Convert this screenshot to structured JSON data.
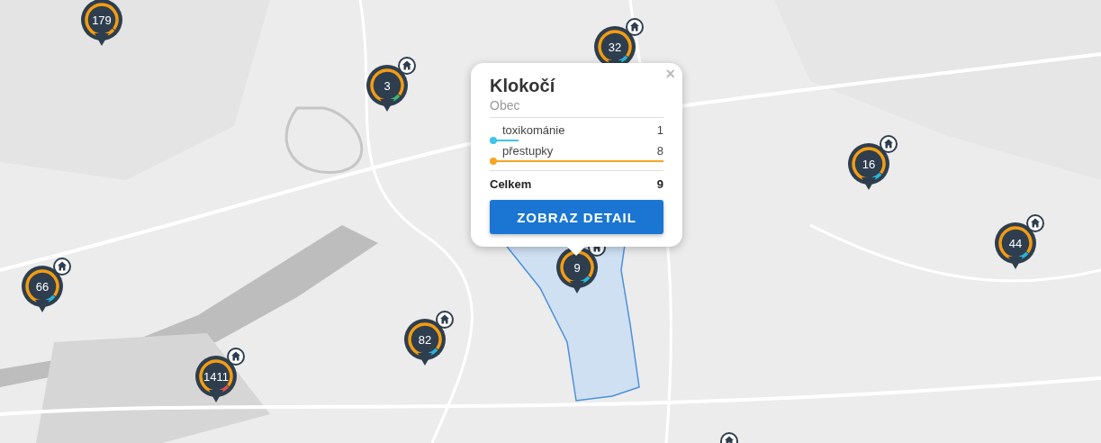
{
  "pins": [
    {
      "count": "179",
      "home": false,
      "color": "#f39c12"
    },
    {
      "count": "3",
      "home": true,
      "color": "#3cb371"
    },
    {
      "count": "32",
      "home": true,
      "color": "#29b6d8"
    },
    {
      "count": "16",
      "home": true,
      "color": "#29b6d8"
    },
    {
      "count": "44",
      "home": true,
      "color": "#29b6d8"
    },
    {
      "count": "66",
      "home": true,
      "color": "#29b6d8"
    },
    {
      "count": "9",
      "home": true,
      "color": "#29b6d8"
    },
    {
      "count": "82",
      "home": true,
      "color": "#29b6d8"
    },
    {
      "count": "1411",
      "home": true,
      "color": "#d9534f"
    }
  ],
  "popup": {
    "title": "Klokočí",
    "subtitle": "Obec",
    "close": "×",
    "rows": [
      {
        "label": "toxikománie",
        "value": "1",
        "level": 0.15,
        "color": "#40c4e8"
      },
      {
        "label": "přestupky",
        "value": "8",
        "level": 1.0,
        "color": "#f5a623"
      }
    ],
    "total_label": "Celkem",
    "total_value": "9",
    "button": "ZOBRAZ DETAIL"
  }
}
